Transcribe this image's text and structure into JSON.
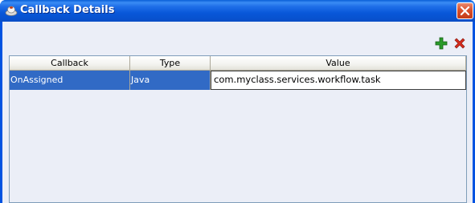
{
  "window": {
    "title": "Callback Details"
  },
  "toolbar": {
    "add_icon": "plus-icon",
    "delete_icon": "x-icon",
    "add_color": "#2a9a2a",
    "delete_color": "#d62b1e"
  },
  "table": {
    "columns": [
      "Callback",
      "Type",
      "Value"
    ],
    "rows": [
      {
        "callback": "OnAssigned",
        "type": "Java",
        "value": "com.myclass.services.workflow.task"
      }
    ],
    "selection_color": "#316ac5"
  }
}
